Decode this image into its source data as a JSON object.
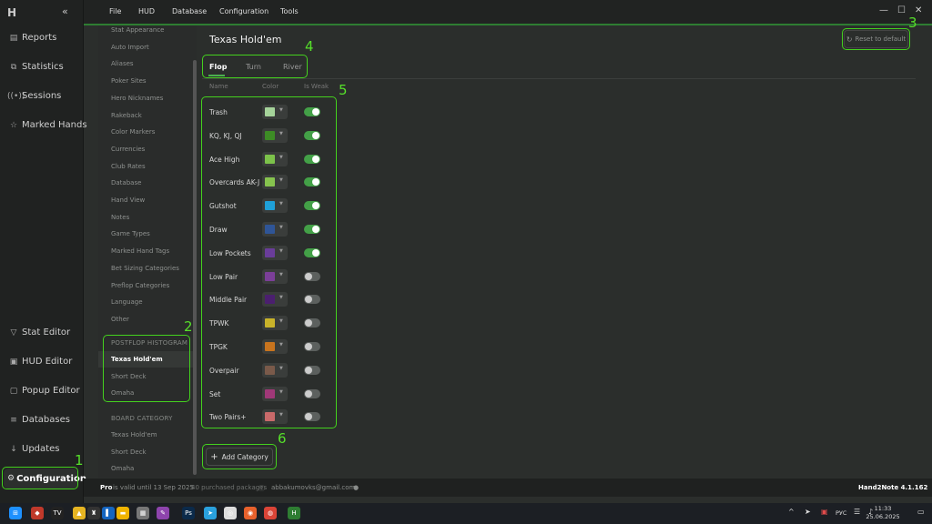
{
  "app": {
    "brand": "H",
    "collapse_icon": "«",
    "menu": [
      "File",
      "HUD",
      "Database",
      "Configuration",
      "Tools"
    ],
    "window_controls": {
      "minimize": "—",
      "maximize": "☐",
      "close": "✕"
    }
  },
  "nav": {
    "top": [
      {
        "icon": "document-icon",
        "glyph": "▤",
        "label": "Reports"
      },
      {
        "icon": "statistics-icon",
        "glyph": "⧉",
        "label": "Statistics"
      },
      {
        "icon": "sessions-icon",
        "glyph": "((•))",
        "label": "Sessions"
      },
      {
        "icon": "star-icon",
        "glyph": "☆",
        "label": "Marked Hands"
      }
    ],
    "bottom": [
      {
        "icon": "stat-editor-icon",
        "glyph": "▽",
        "label": "Stat Editor"
      },
      {
        "icon": "hud-editor-icon",
        "glyph": "▣",
        "label": "HUD Editor"
      },
      {
        "icon": "popup-editor-icon",
        "glyph": "▢",
        "label": "Popup Editor"
      },
      {
        "icon": "database-icon",
        "glyph": "≡",
        "label": "Databases"
      },
      {
        "icon": "download-icon",
        "glyph": "↓",
        "label": "Updates"
      }
    ],
    "active": {
      "icon": "gear-icon",
      "glyph": "⚙",
      "label": "Configuration"
    }
  },
  "settings": {
    "items": [
      "Stat Appearance",
      "Auto Import",
      "Aliases",
      "Poker Sites",
      "Hero Nicknames",
      "Rakeback",
      "Color Markers",
      "Currencies",
      "Club Rates",
      "Database",
      "Hand View",
      "Notes",
      "Game Types",
      "Marked Hand Tags",
      "Bet Sizing Categories",
      "Preflop Categories",
      "Language",
      "Other"
    ],
    "postflop_header": "POSTFLOP HISTOGRAM",
    "postflop_items": [
      "Texas Hold'em",
      "Short Deck",
      "Omaha"
    ],
    "board_header": "BOARD CATEGORY",
    "board_items": [
      "Texas Hold'em",
      "Short Deck",
      "Omaha"
    ]
  },
  "content": {
    "title": "Texas Hold'em",
    "reset_label": "Reset to default",
    "tabs": [
      "Flop",
      "Turn",
      "River"
    ],
    "col_name": "Name",
    "col_color": "Color",
    "col_weak": "Is Weak",
    "rows": [
      {
        "name": "Trash",
        "color": "#a5d39a",
        "weak": true
      },
      {
        "name": "KQ, KJ, QJ",
        "color": "#3d8c25",
        "weak": true
      },
      {
        "name": "Ace High",
        "color": "#7cc24a",
        "weak": true
      },
      {
        "name": "Overcards AK-J",
        "color": "#86c34e",
        "weak": true
      },
      {
        "name": "Gutshot",
        "color": "#1fa0d8",
        "weak": true
      },
      {
        "name": "Draw",
        "color": "#2f5597",
        "weak": true
      },
      {
        "name": "Low Pockets",
        "color": "#6a3d9a",
        "weak": true
      },
      {
        "name": "Low Pair",
        "color": "#7b3f98",
        "weak": false
      },
      {
        "name": "Middle Pair",
        "color": "#4b1f6f",
        "weak": false
      },
      {
        "name": "TPWK",
        "color": "#c9b32a",
        "weak": false
      },
      {
        "name": "TPGK",
        "color": "#c8741e",
        "weak": false
      },
      {
        "name": "Overpair",
        "color": "#7a5a4a",
        "weak": false
      },
      {
        "name": "Set",
        "color": "#a03878",
        "weak": false
      },
      {
        "name": "Two Pairs+",
        "color": "#c96a6a",
        "weak": false
      }
    ],
    "add_label": "Add Category"
  },
  "status": {
    "plan": "Pro",
    "valid": "is valid until 13 Sep 2025",
    "packages": "40 purchased packages",
    "email": "abbakumovks@gmail.com",
    "version": "Hand2Note 4.1.162"
  },
  "annotations": [
    "1",
    "2",
    "3",
    "4",
    "5",
    "6"
  ],
  "taskbar": {
    "lang": "РУС",
    "time": "11:33",
    "date": "25.06.2025",
    "apps": [
      {
        "name": "windows-start-icon",
        "color": "#1e90ff",
        "glyph": "⊞"
      },
      {
        "name": "app-icon-1",
        "color": "#c0392b",
        "glyph": "◆"
      },
      {
        "name": "tradingview-icon",
        "color": "#222",
        "glyph": "TV"
      },
      {
        "name": "app-icon-3",
        "color": "#e6b422",
        "glyph": "▲"
      },
      {
        "name": "app-icon-4",
        "color": "#333",
        "glyph": "♜"
      },
      {
        "name": "app-icon-5",
        "color": "#1565c0",
        "glyph": "▌"
      },
      {
        "name": "explorer-icon",
        "color": "#f0b400",
        "glyph": "▬"
      },
      {
        "name": "app-icon-7",
        "color": "#777",
        "glyph": "▦"
      },
      {
        "name": "app-icon-8",
        "color": "#8e44ad",
        "glyph": "✎"
      },
      {
        "name": "photoshop-icon",
        "color": "#0b2a4a",
        "glyph": "Ps"
      },
      {
        "name": "telegram-icon",
        "color": "#2aa1de",
        "glyph": "➤"
      },
      {
        "name": "app-icon-11",
        "color": "#ddd",
        "glyph": "◎"
      },
      {
        "name": "firefox-icon",
        "color": "#e8612c",
        "glyph": "◉"
      },
      {
        "name": "chrome-icon",
        "color": "#db4437",
        "glyph": "◍"
      },
      {
        "name": "hand2note-icon",
        "color": "#2e7d32",
        "glyph": "H"
      }
    ]
  }
}
